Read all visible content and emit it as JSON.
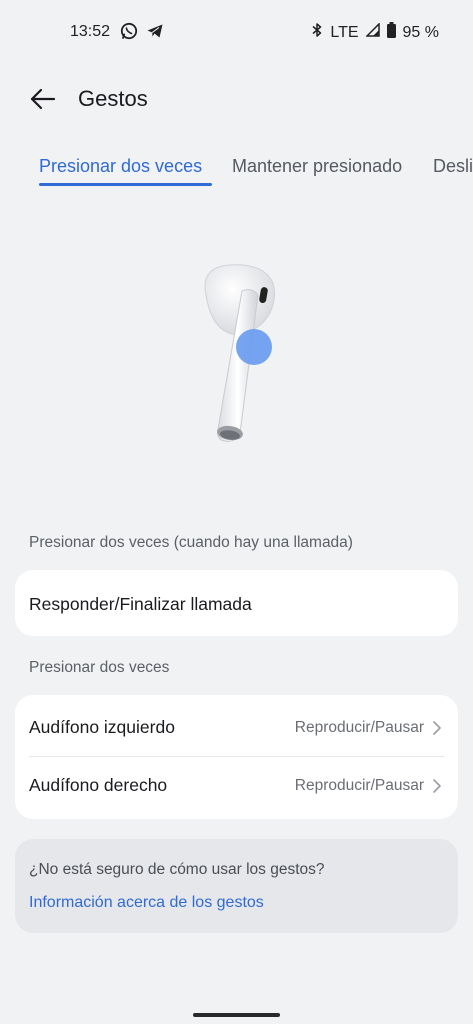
{
  "status_bar": {
    "time": "13:52",
    "left_icons": [
      "whatsapp-icon",
      "telegram-icon"
    ],
    "network": "LTE",
    "battery": "95 %"
  },
  "app_bar": {
    "title": "Gestos"
  },
  "tabs": [
    {
      "label": "Presionar dos veces",
      "active": true
    },
    {
      "label": "Mantener presionado",
      "active": false
    },
    {
      "label": "Deslizar",
      "active": false
    }
  ],
  "section_call": {
    "header": "Presionar dos veces (cuando hay una llamada)",
    "row_label": "Responder/Finalizar llamada"
  },
  "section_double": {
    "header": "Presionar dos veces",
    "rows": [
      {
        "label": "Audífono izquierdo",
        "value": "Reproducir/Pausar"
      },
      {
        "label": "Audífono derecho",
        "value": "Reproducir/Pausar"
      }
    ]
  },
  "info": {
    "question": "¿No está seguro de cómo usar los gestos?",
    "link": "Información acerca de los gestos"
  },
  "colors": {
    "accent": "#2f6ad6",
    "background": "#f1f2f4",
    "card": "#ffffff",
    "touch_point": "#6a9cf0"
  }
}
